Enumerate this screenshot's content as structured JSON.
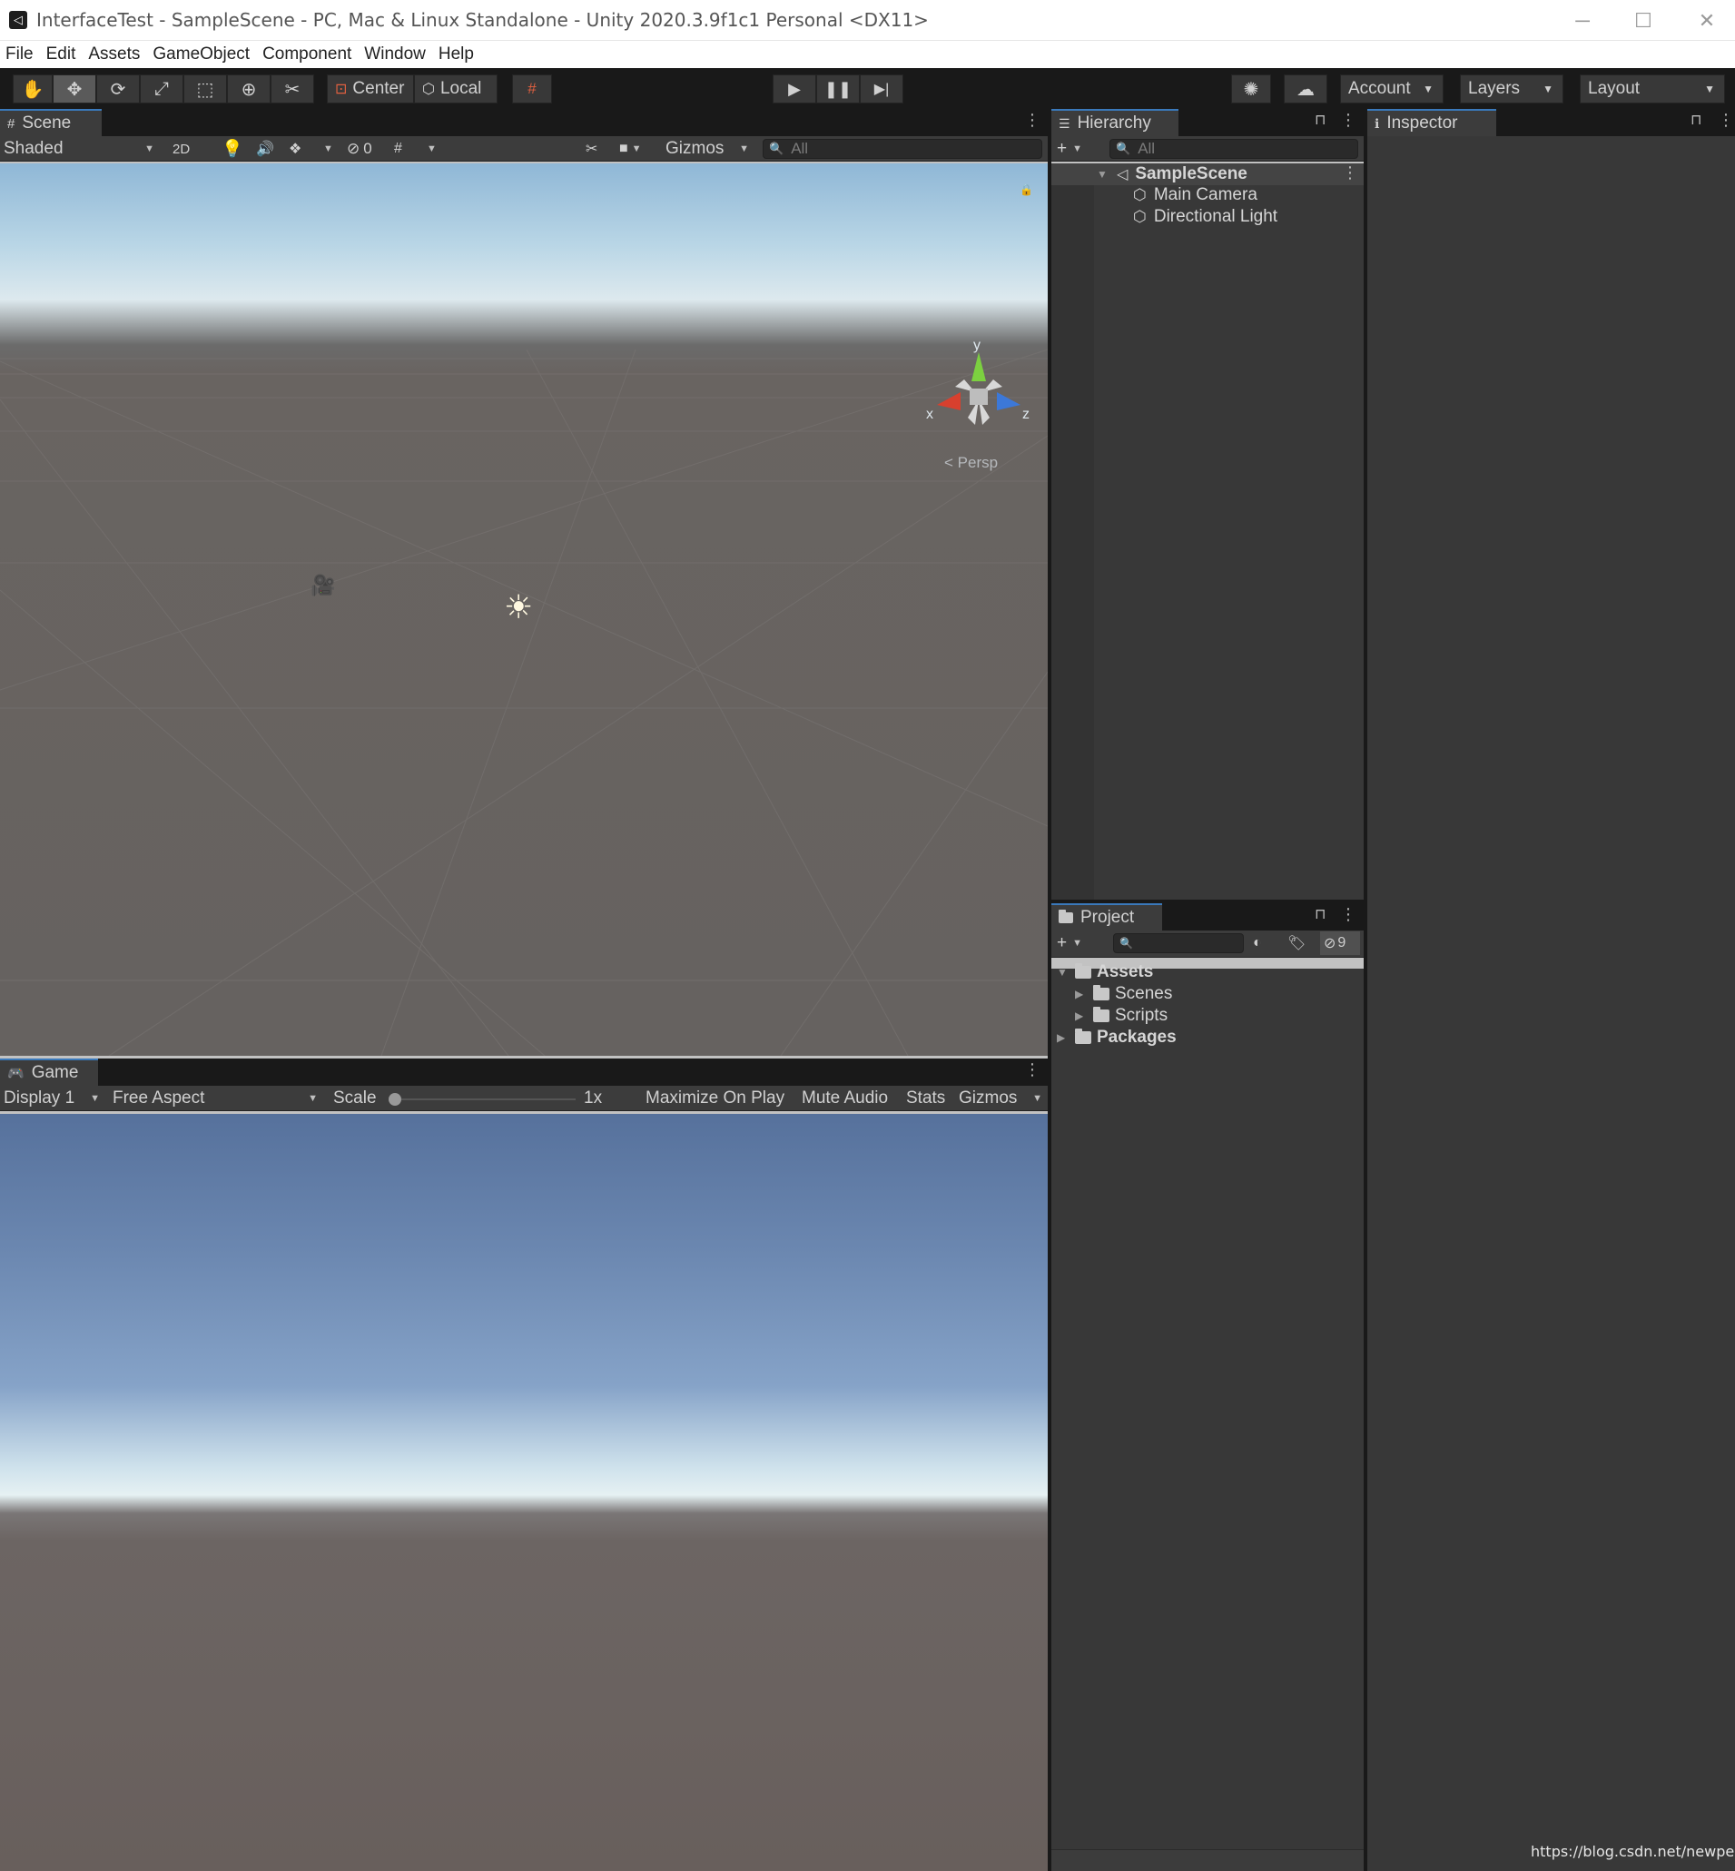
{
  "window": {
    "title": "InterfaceTest - SampleScene - PC, Mac & Linux Standalone - Unity 2020.3.9f1c1 Personal <DX11>",
    "minimize_icon": "minimize-icon",
    "maximize_icon": "maximize-icon",
    "close_icon": "close-icon"
  },
  "menu": [
    "File",
    "Edit",
    "Assets",
    "GameObject",
    "Component",
    "Window",
    "Help"
  ],
  "toolbar": {
    "pivot_label": "Center",
    "space_label": "Local",
    "account_label": "Account",
    "layers_label": "Layers",
    "layout_label": "Layout"
  },
  "scene": {
    "tab_label": "Scene",
    "shading_mode": "Shaded",
    "mode_2d": "2D",
    "hidden_count": "0",
    "gizmos_label": "Gizmos",
    "search_placeholder": "All",
    "axis_x": "x",
    "axis_y": "y",
    "axis_z": "z",
    "projection_label": "< Persp"
  },
  "game": {
    "tab_label": "Game",
    "display": "Display 1",
    "aspect": "Free Aspect",
    "scale_label": "Scale",
    "scale_value": "1x",
    "maximize_label": "Maximize On Play",
    "mute_label": "Mute Audio",
    "stats_label": "Stats",
    "gizmos_label": "Gizmos"
  },
  "hierarchy": {
    "tab_label": "Hierarchy",
    "search_placeholder": "All",
    "scene_name": "SampleScene",
    "items": [
      "Main Camera",
      "Directional Light"
    ]
  },
  "project": {
    "tab_label": "Project",
    "hidden_count": "9",
    "tree": {
      "assets": "Assets",
      "scenes": "Scenes",
      "scripts": "Scripts",
      "packages": "Packages"
    }
  },
  "inspector": {
    "tab_label": "Inspector"
  },
  "watermark": "https://blog.csdn.net/newperso"
}
